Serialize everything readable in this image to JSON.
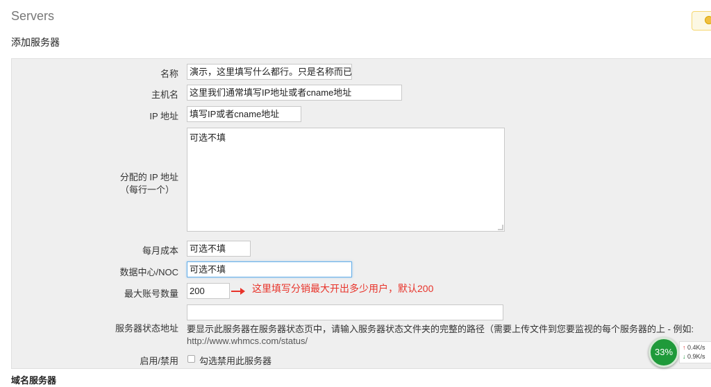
{
  "page": {
    "title": "Servers",
    "section_title": "添加服务器",
    "bottom_section_title": "域名服务器"
  },
  "form": {
    "name": {
      "label": "名称",
      "value": "演示，这里填写什么都行。只是名称而已"
    },
    "hostname": {
      "label": "主机名",
      "value": "这里我们通常填写IP地址或者cname地址"
    },
    "ip": {
      "label": "IP 地址",
      "value": "填写IP或者cname地址"
    },
    "assigned_ips": {
      "label_line1": "分配的 IP 地址",
      "label_line2": "（每行一个）",
      "value": "可选不填"
    },
    "monthly_cost": {
      "label": "每月成本",
      "value": "可选不填"
    },
    "datacenter": {
      "label": "数据中心/NOC",
      "value": "可选不填"
    },
    "max_accounts": {
      "label": "最大账号数量",
      "value": "200",
      "annotation": "这里填写分销最大开出多少用户，默认200"
    },
    "status_address": {
      "label": "服务器状态地址",
      "value": "",
      "help": "要显示此服务器在服务器状态页中，请输入服务器状态文件夹的完整的路径（需要上传文件到您要监视的每个服务器的上 - 例如:",
      "help_url": "http://www.whmcs.com/status/"
    },
    "disable": {
      "label": "启用/禁用",
      "checkbox_label": "勾选禁用此服务器",
      "checked": false
    }
  },
  "net_widget": {
    "percent": "33%",
    "upload": "0.4K/s",
    "download": "0.9K/s"
  },
  "colors": {
    "annotation": "#e8332a",
    "widget_green": "#1f9a3a",
    "focus_border": "#66afe9"
  }
}
